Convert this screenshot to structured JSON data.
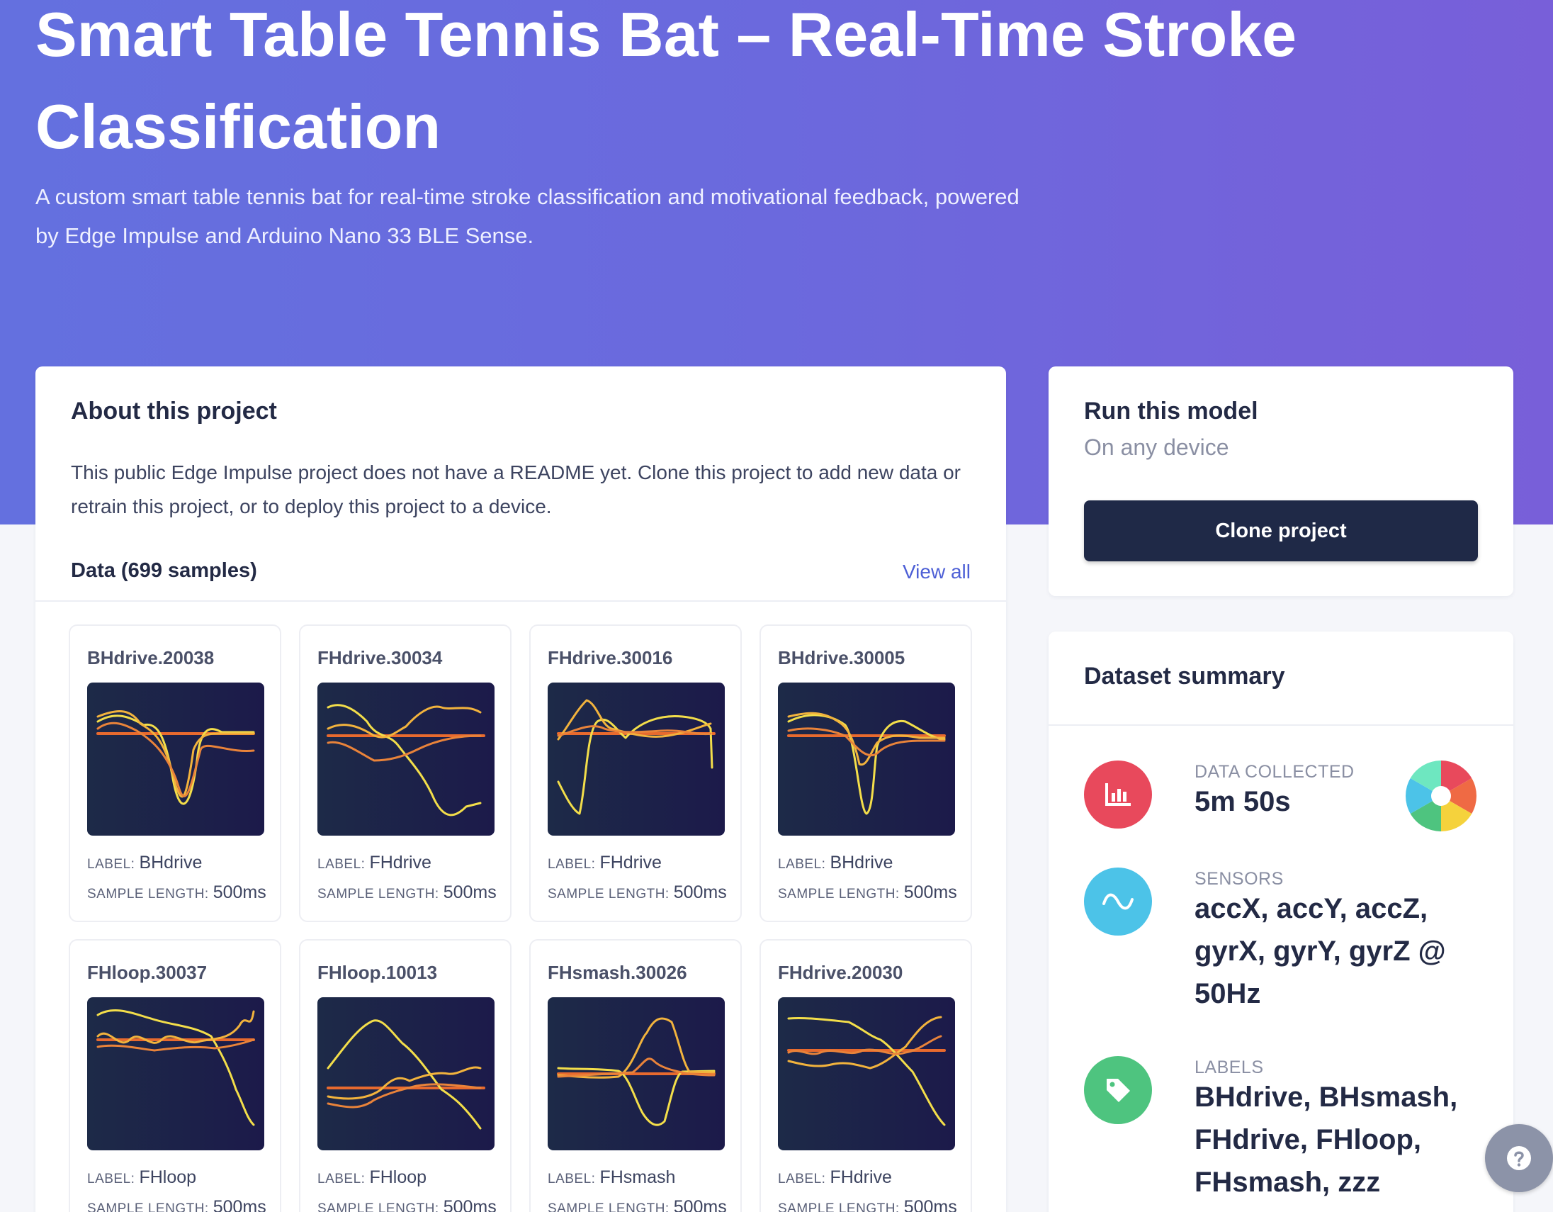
{
  "hero": {
    "title": "Smart Table Tennis Bat – Real-Time Stroke Classification",
    "description": "A custom smart table tennis bat for real-time stroke classification and motivational feedback, powered by Edge Impulse and Arduino Nano 33 BLE Sense."
  },
  "about": {
    "heading": "About this project",
    "text": "This public Edge Impulse project does not have a README yet. Clone this project to add new data or retrain this project, or to deploy this project to a device."
  },
  "data": {
    "title": "Data (699 samples)",
    "view_all": "View all",
    "label_key": "LABEL:",
    "length_key": "SAMPLE LENGTH:",
    "samples": [
      {
        "name": "BHdrive.20038",
        "label": "BHdrive",
        "length": "500ms"
      },
      {
        "name": "FHdrive.30034",
        "label": "FHdrive",
        "length": "500ms"
      },
      {
        "name": "FHdrive.30016",
        "label": "FHdrive",
        "length": "500ms"
      },
      {
        "name": "BHdrive.30005",
        "label": "BHdrive",
        "length": "500ms"
      },
      {
        "name": "FHloop.30037",
        "label": "FHloop",
        "length": "500ms"
      },
      {
        "name": "FHloop.10013",
        "label": "FHloop",
        "length": "500ms"
      },
      {
        "name": "FHsmash.30026",
        "label": "FHsmash",
        "length": "500ms"
      },
      {
        "name": "FHdrive.20030",
        "label": "FHdrive",
        "length": "500ms"
      }
    ]
  },
  "run": {
    "heading": "Run this model",
    "subheading": "On any device",
    "clone_label": "Clone project"
  },
  "dataset": {
    "heading": "Dataset summary",
    "data_collected_label": "DATA COLLECTED",
    "data_collected_value": "5m 50s",
    "sensors_label": "SENSORS",
    "sensors_value": "accX, accY, accZ, gyrX, gyrY, gyrZ @ 50Hz",
    "labels_label": "LABELS",
    "labels_value": "BHdrive, BHsmash, FHdrive, FHloop, FHsmash, zzz"
  },
  "colors": {
    "hero_start": "#6470df",
    "hero_end": "#785fd9",
    "button_dark": "#1f2947",
    "link": "#4d5fd6",
    "icon_data": "#e8495c",
    "icon_sensors": "#4cc3e8",
    "icon_labels": "#4ec47f",
    "help": "#8c93a8"
  },
  "icons": {
    "data_collected": "bar-chart-icon",
    "sensors": "wave-icon",
    "labels": "tag-icon",
    "pie": "pie-chart-icon",
    "help": "question-icon"
  }
}
